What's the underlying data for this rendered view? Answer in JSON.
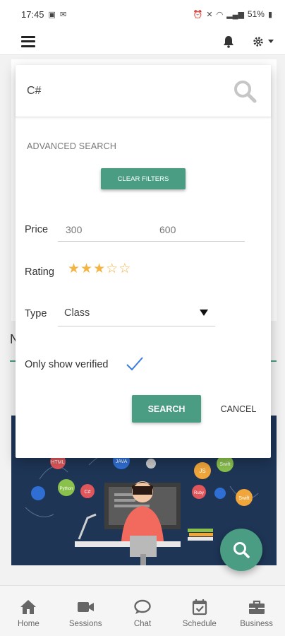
{
  "status_bar": {
    "time": "17:45",
    "battery": "51%"
  },
  "search": {
    "value": "C#"
  },
  "advanced": {
    "title": "ADVANCED SEARCH",
    "clear_label": "CLEAR FILTERS",
    "price_label": "Price",
    "price_min": "300",
    "price_max": "600",
    "rating_label": "Rating",
    "rating": {
      "value": 3,
      "max": 5
    },
    "type_label": "Type",
    "type_value": "Class",
    "verified_label": "Only show verified",
    "verified_checked": true,
    "search_label": "SEARCH",
    "cancel_label": "CANCEL"
  },
  "background": {
    "header_fragment": "N"
  },
  "banner": {
    "tags": [
      "HTML",
      "JAVA",
      "JS",
      "Swift",
      "Python",
      "C#",
      "Ruby",
      "Swift"
    ]
  },
  "nav": [
    {
      "label": "Home",
      "icon": "home-icon"
    },
    {
      "label": "Sessions",
      "icon": "video-icon"
    },
    {
      "label": "Chat",
      "icon": "chat-icon"
    },
    {
      "label": "Schedule",
      "icon": "calendar-check-icon"
    },
    {
      "label": "Business",
      "icon": "briefcase-icon"
    }
  ],
  "colors": {
    "accent": "#4a9c82",
    "star": "#f4b443",
    "banner": "#1e3556"
  }
}
